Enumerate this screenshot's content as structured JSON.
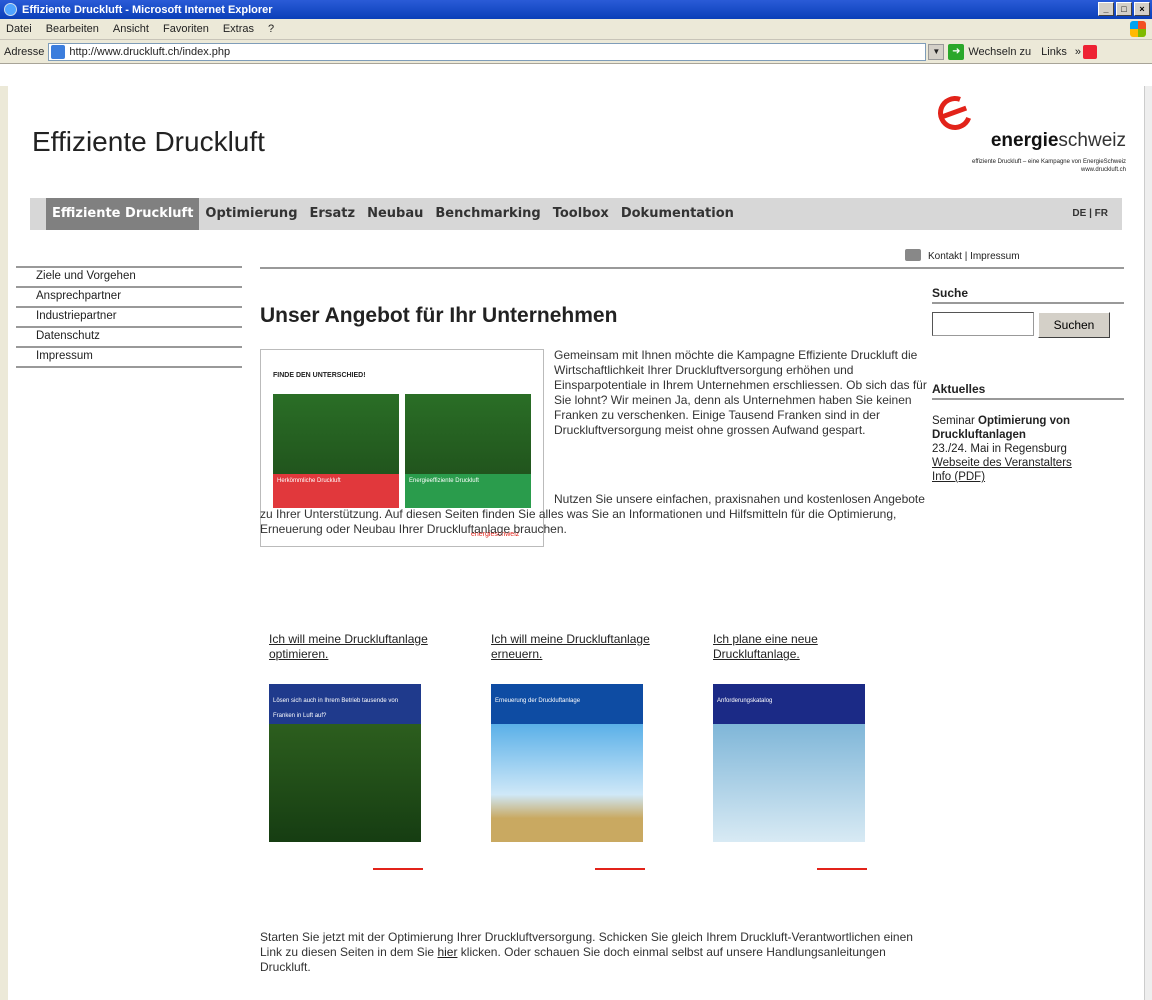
{
  "window": {
    "title": "Effiziente Druckluft - Microsoft Internet Explorer",
    "buttons": [
      "_",
      "□",
      "×"
    ]
  },
  "menubar": {
    "items": [
      "Datei",
      "Bearbeiten",
      "Ansicht",
      "Favoriten",
      "Extras",
      "?"
    ]
  },
  "addressbar": {
    "label": "Adresse",
    "url": "http://www.druckluft.ch/index.php",
    "go_label": "Wechseln zu",
    "links_label": "Links"
  },
  "site": {
    "title": "Effiziente Druckluft",
    "logo_brand_bold": "energie",
    "logo_brand_light": "schweiz",
    "logo_tagline": "effiziente Druckluft – eine Kampagne von EnergieSchweiz",
    "logo_url": "www.druckluft.ch"
  },
  "nav": {
    "items": [
      "Effiziente Druckluft",
      "Optimierung",
      "Ersatz",
      "Neubau",
      "Benchmarking",
      "Toolbox",
      "Dokumentation"
    ],
    "lang": "DE | FR"
  },
  "leftnav": {
    "items": [
      "Ziele und Vorgehen",
      "Ansprechpartner",
      "Industriepartner",
      "Datenschutz",
      "Impressum"
    ]
  },
  "toplinks": {
    "text": "Kontakt | Impressum"
  },
  "main": {
    "headline": "Unser Angebot für Ihr Unternehmen",
    "hero_header": "FINDE DEN UNTERSCHIED!",
    "hero_left_label": "Herkömmliche Druckluft",
    "hero_right_label": "Energieeffiziente Druckluft",
    "intro_p1": "Gemeinsam mit Ihnen möchte die Kampagne Effiziente Druckluft die Wirtschaftlichkeit Ihrer Druckluftversorgung erhöhen und Einsparpotentiale in Ihrem Unternehmen erschliessen. Ob sich das für Sie lohnt? Wir meinen Ja, denn als Unternehmen haben Sie keinen Franken zu verschenken. Einige Tausend Franken sind in der Druckluftversorgung meist ohne grossen Aufwand gespart.",
    "intro_p2": "Nutzen Sie unsere einfachen, praxisnahen und kostenlosen Angebote zu Ihrer Unterstützung. Auf diesen Seiten finden Sie alles was Sie an Informationen und Hilfsmitteln für die Optimierung, Erneuerung oder Neubau Ihrer Druckluftanlage brauchen.",
    "teasers": [
      {
        "link": "Ich will meine Druckluftanlage optimieren.",
        "cover_text": "Lösen sich auch in Ihrem Betrieb tausende von Franken in Luft auf?"
      },
      {
        "link": "Ich will meine Druckluftanlage erneuern.",
        "cover_text": "Erneuerung der Druckluftanlage"
      },
      {
        "link": "Ich plane eine neue Druckluftanlage.",
        "cover_text": "Anforderungskatalog"
      }
    ],
    "outro_before": "Starten Sie jetzt mit der Optimierung Ihrer Druckluftversorgung. Schicken Sie gleich Ihrem Druckluft-Verantwortlichen einen Link zu diesen Seiten in dem Sie ",
    "outro_link": "hier",
    "outro_after": " klicken. Oder schauen Sie doch einmal selbst auf unsere Handlungsanleitungen Druckluft."
  },
  "sidebar": {
    "search_heading": "Suche",
    "search_value": "",
    "search_button": "Suchen",
    "news_heading": "Aktuelles",
    "news_prefix": "Seminar ",
    "news_bold": "Optimierung von Druckluftanlagen",
    "news_date": "23./24. Mai in Regensburg",
    "news_link": "Webseite des Veranstalters",
    "news_pdf": "Info (PDF)"
  },
  "colors": {
    "brand_red": "#e2231a",
    "nav_bg": "#d7d7d7",
    "nav_active": "#808080"
  }
}
